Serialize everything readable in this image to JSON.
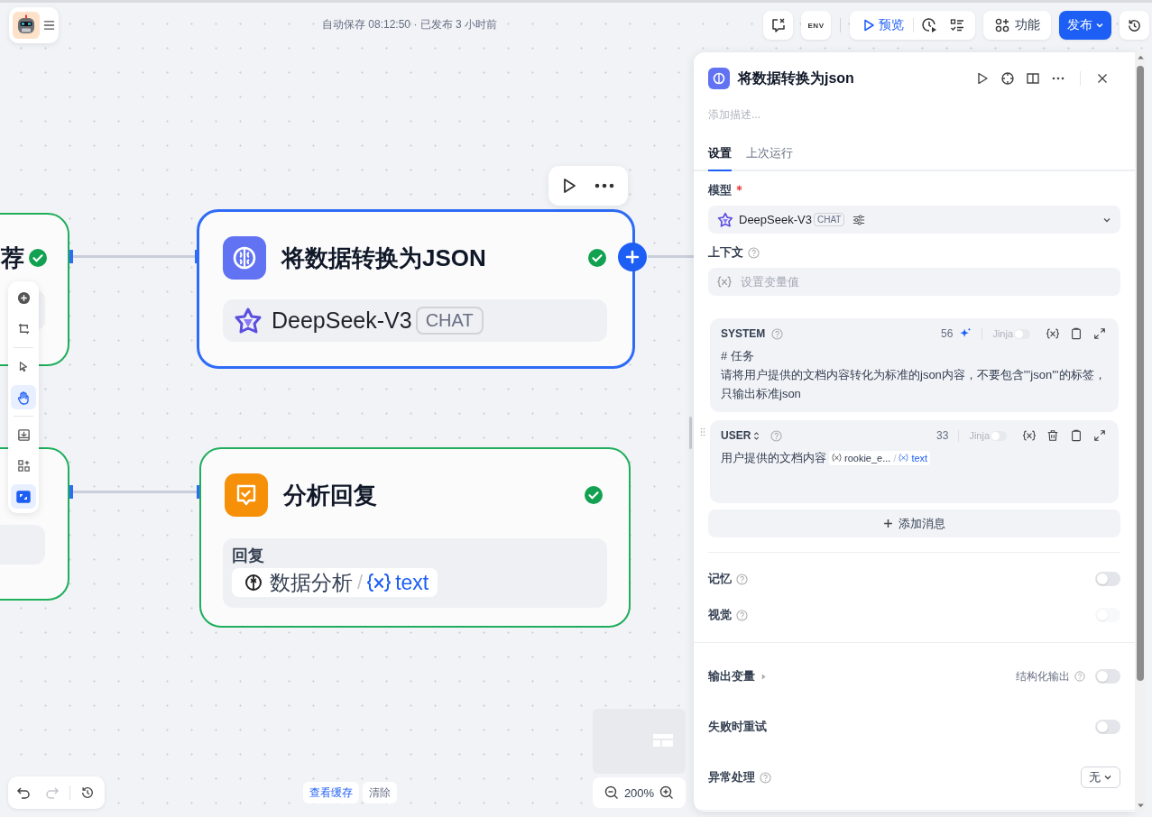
{
  "header": {
    "status": "自动保存 08:12:50 · 已发布 3 小时前"
  },
  "top_actions": {
    "env_label": "ENV",
    "preview": "预览",
    "features": "功能",
    "publish": "发布"
  },
  "canvas_tools": [
    {
      "kind": "add",
      "selected": false
    },
    {
      "kind": "note",
      "selected": false
    },
    {
      "kind": "pointer",
      "selected": false
    },
    {
      "kind": "hand",
      "selected": true
    },
    {
      "kind": "export",
      "selected": false
    },
    {
      "kind": "organize",
      "selected": false
    },
    {
      "kind": "minimap",
      "selected": true
    }
  ],
  "nodes": [
    {
      "kind": "partial",
      "title": "荐",
      "done": true
    },
    {
      "kind": "partial"
    },
    {
      "kind": "llm",
      "title": "将数据转换为JSON",
      "done": true,
      "selected": true,
      "model": "DeepSeek-V3",
      "model_tag": "CHAT"
    },
    {
      "kind": "answer",
      "title": "分析回复",
      "done": true,
      "selected": false,
      "output_label": "回复",
      "source": "数据分析",
      "separator": "/",
      "variable": "text"
    }
  ],
  "history": {
    "undo_disabled": false,
    "redo_disabled": true
  },
  "cache": {
    "view": "查看缓存",
    "clear": "清除"
  },
  "zoom": "200%",
  "panel": {
    "title": "将数据转换为json",
    "description_placeholder": "添加描述...",
    "tabs": [
      {
        "label": "设置",
        "selected": true
      },
      {
        "label": "上次运行",
        "selected": false
      }
    ],
    "model": {
      "label": "模型",
      "required": true,
      "name": "DeepSeek-V3",
      "tag": "CHAT"
    },
    "context": {
      "label": "上下文",
      "placeholder": "设置变量值"
    },
    "messages": [
      {
        "kind": "system",
        "role": "SYSTEM",
        "count": "56",
        "jinja_label": "Jinja",
        "jinja": false,
        "lines": [
          "# 任务",
          "请将用户提供的文档内容转化为标准的json内容，不要包含'''json'''的标签，只输出标准json"
        ]
      },
      {
        "kind": "user",
        "role": "USER",
        "count": "33",
        "jinja_label": "Jinja",
        "jinja": false,
        "text": "用户提供的文档内容",
        "var_source": "rookie_e...",
        "var_separator": "/",
        "var_name": "text"
      }
    ],
    "add_message": "添加消息",
    "settings": [
      {
        "kind": "toggle",
        "label": "记忆",
        "help": true,
        "on": false,
        "disabled": false
      },
      {
        "kind": "toggle",
        "label": "视觉",
        "help": true,
        "on": false,
        "disabled": true
      },
      {
        "kind": "output",
        "label": "输出变量",
        "extra_label": "结构化输出",
        "on": false
      },
      {
        "kind": "toggle",
        "label": "失败时重试",
        "help": false,
        "on": false,
        "disabled": false
      },
      {
        "kind": "select",
        "label": "异常处理",
        "help": true,
        "value": "无"
      }
    ]
  }
}
